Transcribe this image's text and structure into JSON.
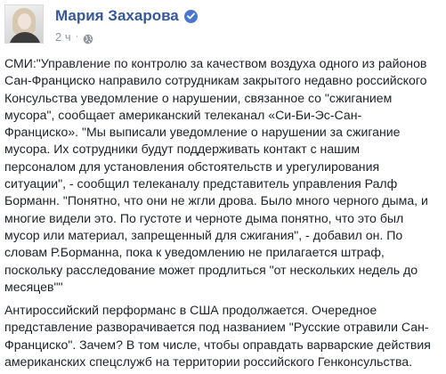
{
  "post": {
    "author": "Мария Захарова",
    "timestamp": "2 ч",
    "separator": "·",
    "icons": {
      "verified": "verified-badge-icon",
      "audience": "globe-icon"
    },
    "colors": {
      "author_link": "#365899",
      "verified_badge": "#4b76cf",
      "meta_text": "#90949c",
      "body_text": "#1d2129"
    },
    "paragraphs": [
      "СМИ:\"Управление по контролю за качеством воздуха одного из районов\nСан-Франциско направило сотрудникам закрытого недавно российского\nКонсульства уведомление о нарушении, связанное со \"сжиганием\nмусора\", сообщает американский телеканал «Си-Би-Эс-Сан-\nФранциско». \"Мы выписали уведомление о нарушении за сжигание\nмусора. Их сотрудники будут поддерживать контакт с нашим\nперсоналом для установления обстоятельств и урегулирования\nситуации\", - сообщил телеканалу представитель управления Ралф\nБорманн. \"Понятно, что они не жгли дрова. Было много черного дыма, и\nмногие видели это. По густоте и черноте дыма понятно, что это был\nмусор или материал, запрещенный для сжигания\", - добавил он. По\nсловам Р.Борманна, пока к уведомлению не прилагается штраф,\nпоскольку расследование может продлиться \"от нескольких недель до\nмесяцев\"\"",
      "Антироссийский перформанс в США продолжается. Очередное\nпредставление разворачивается под названием \"Русские отравили Сан-\nФранциско\". Зачем? В том числе, чтобы оправдать варварские действия\nамериканских спецслужб на территории российского Генконсульства."
    ]
  }
}
